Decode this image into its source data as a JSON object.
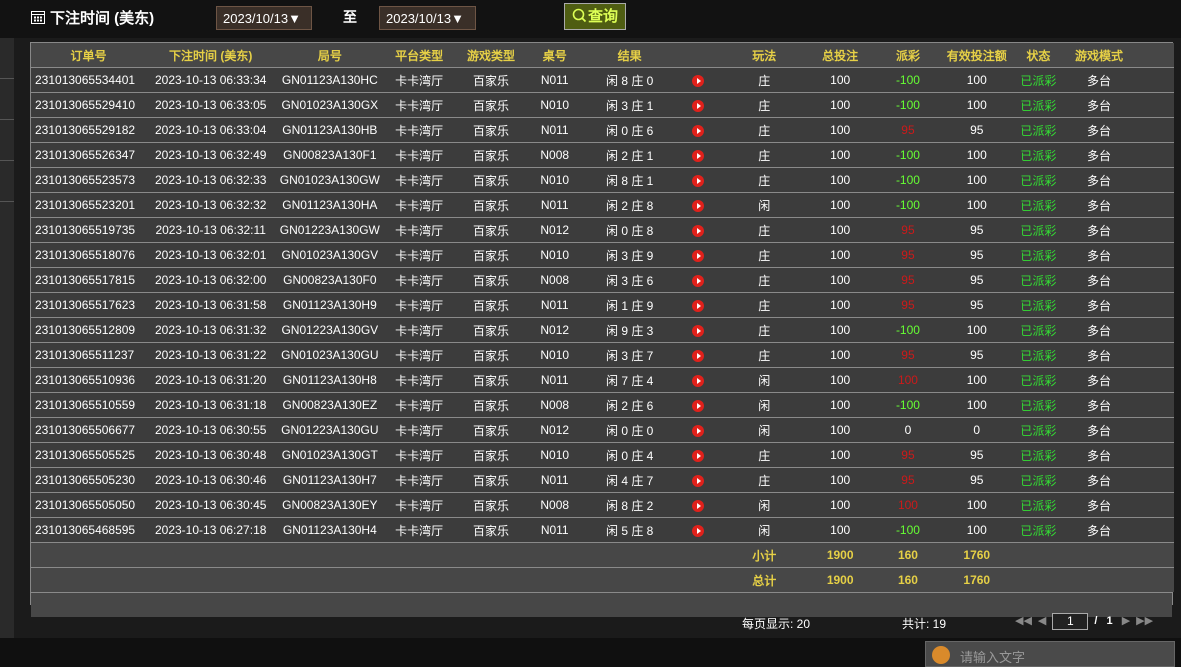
{
  "header": {
    "title": "下注时间 (美东)",
    "date_from": "2023/10/13▼",
    "to_label": "至",
    "date_to": "2023/10/13▼",
    "query_label": "查询"
  },
  "table": {
    "columns": [
      "订单号",
      "下注时间 (美东)",
      "局号",
      "平台类型",
      "游戏类型",
      "桌号",
      "结果",
      "",
      "玩法",
      "总投注",
      "派彩",
      "有效投注额",
      "状态",
      "游戏模式"
    ],
    "rows": [
      [
        "231013065534401",
        "2023-10-13 06:33:34",
        "GN01123A130HC",
        "卡卡湾厅",
        "百家乐",
        "N011",
        "闲 8 庄 0",
        "庄",
        "100",
        "-100",
        "100",
        "已派彩",
        "多台"
      ],
      [
        "231013065529410",
        "2023-10-13 06:33:05",
        "GN01023A130GX",
        "卡卡湾厅",
        "百家乐",
        "N010",
        "闲 3 庄 1",
        "庄",
        "100",
        "-100",
        "100",
        "已派彩",
        "多台"
      ],
      [
        "231013065529182",
        "2023-10-13 06:33:04",
        "GN01123A130HB",
        "卡卡湾厅",
        "百家乐",
        "N011",
        "闲 0 庄 6",
        "庄",
        "100",
        "95",
        "95",
        "已派彩",
        "多台"
      ],
      [
        "231013065526347",
        "2023-10-13 06:32:49",
        "GN00823A130F1",
        "卡卡湾厅",
        "百家乐",
        "N008",
        "闲 2 庄 1",
        "庄",
        "100",
        "-100",
        "100",
        "已派彩",
        "多台"
      ],
      [
        "231013065523573",
        "2023-10-13 06:32:33",
        "GN01023A130GW",
        "卡卡湾厅",
        "百家乐",
        "N010",
        "闲 8 庄 1",
        "庄",
        "100",
        "-100",
        "100",
        "已派彩",
        "多台"
      ],
      [
        "231013065523201",
        "2023-10-13 06:32:32",
        "GN01123A130HA",
        "卡卡湾厅",
        "百家乐",
        "N011",
        "闲 2 庄 8",
        "闲",
        "100",
        "-100",
        "100",
        "已派彩",
        "多台"
      ],
      [
        "231013065519735",
        "2023-10-13 06:32:11",
        "GN01223A130GW",
        "卡卡湾厅",
        "百家乐",
        "N012",
        "闲 0 庄 8",
        "庄",
        "100",
        "95",
        "95",
        "已派彩",
        "多台"
      ],
      [
        "231013065518076",
        "2023-10-13 06:32:01",
        "GN01023A130GV",
        "卡卡湾厅",
        "百家乐",
        "N010",
        "闲 3 庄 9",
        "庄",
        "100",
        "95",
        "95",
        "已派彩",
        "多台"
      ],
      [
        "231013065517815",
        "2023-10-13 06:32:00",
        "GN00823A130F0",
        "卡卡湾厅",
        "百家乐",
        "N008",
        "闲 3 庄 6",
        "庄",
        "100",
        "95",
        "95",
        "已派彩",
        "多台"
      ],
      [
        "231013065517623",
        "2023-10-13 06:31:58",
        "GN01123A130H9",
        "卡卡湾厅",
        "百家乐",
        "N011",
        "闲 1 庄 9",
        "庄",
        "100",
        "95",
        "95",
        "已派彩",
        "多台"
      ],
      [
        "231013065512809",
        "2023-10-13 06:31:32",
        "GN01223A130GV",
        "卡卡湾厅",
        "百家乐",
        "N012",
        "闲 9 庄 3",
        "庄",
        "100",
        "-100",
        "100",
        "已派彩",
        "多台"
      ],
      [
        "231013065511237",
        "2023-10-13 06:31:22",
        "GN01023A130GU",
        "卡卡湾厅",
        "百家乐",
        "N010",
        "闲 3 庄 7",
        "庄",
        "100",
        "95",
        "95",
        "已派彩",
        "多台"
      ],
      [
        "231013065510936",
        "2023-10-13 06:31:20",
        "GN01123A130H8",
        "卡卡湾厅",
        "百家乐",
        "N011",
        "闲 7 庄 4",
        "闲",
        "100",
        "100",
        "100",
        "已派彩",
        "多台"
      ],
      [
        "231013065510559",
        "2023-10-13 06:31:18",
        "GN00823A130EZ",
        "卡卡湾厅",
        "百家乐",
        "N008",
        "闲 2 庄 6",
        "闲",
        "100",
        "-100",
        "100",
        "已派彩",
        "多台"
      ],
      [
        "231013065506677",
        "2023-10-13 06:30:55",
        "GN01223A130GU",
        "卡卡湾厅",
        "百家乐",
        "N012",
        "闲 0 庄 0",
        "闲",
        "100",
        "0",
        "0",
        "已派彩",
        "多台"
      ],
      [
        "231013065505525",
        "2023-10-13 06:30:48",
        "GN01023A130GT",
        "卡卡湾厅",
        "百家乐",
        "N010",
        "闲 0 庄 4",
        "庄",
        "100",
        "95",
        "95",
        "已派彩",
        "多台"
      ],
      [
        "231013065505230",
        "2023-10-13 06:30:46",
        "GN01123A130H7",
        "卡卡湾厅",
        "百家乐",
        "N011",
        "闲 4 庄 7",
        "庄",
        "100",
        "95",
        "95",
        "已派彩",
        "多台"
      ],
      [
        "231013065505050",
        "2023-10-13 06:30:45",
        "GN00823A130EY",
        "卡卡湾厅",
        "百家乐",
        "N008",
        "闲 8 庄 2",
        "闲",
        "100",
        "100",
        "100",
        "已派彩",
        "多台"
      ],
      [
        "231013065468595",
        "2023-10-13 06:27:18",
        "GN01123A130H4",
        "卡卡湾厅",
        "百家乐",
        "N011",
        "闲 5 庄 8",
        "闲",
        "100",
        "-100",
        "100",
        "已派彩",
        "多台"
      ]
    ],
    "subtotal": {
      "label": "小计",
      "total_bet": "1900",
      "payout": "160",
      "valid_bet": "1760"
    },
    "grandtotal": {
      "label": "总计",
      "total_bet": "1900",
      "payout": "160",
      "valid_bet": "1760"
    }
  },
  "footer": {
    "per_page": "每页显示: 20",
    "total": "共计: 19",
    "page_input": "1",
    "page_sep": "/",
    "page_count": "1"
  },
  "chat": {
    "placeholder": "请输入文字"
  },
  "colors": {
    "header_text": "#e6d046",
    "positive": "#66ff33",
    "negative": "#cc1a1a",
    "status": "#33dd33"
  }
}
